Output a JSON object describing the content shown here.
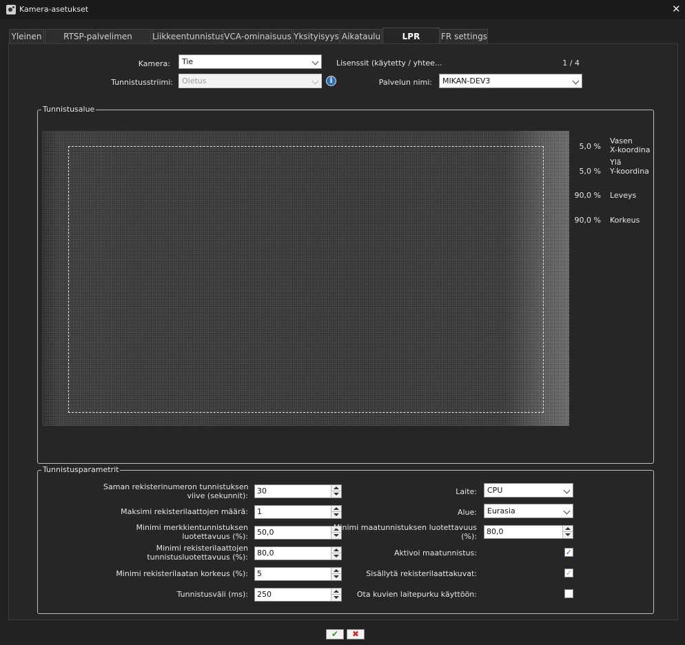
{
  "window": {
    "title": "Kamera-asetukset"
  },
  "tabs": [
    {
      "label": "Yleinen"
    },
    {
      "label": "RTSP-palvelimen striimaus"
    },
    {
      "label": "Liikkeentunnistus"
    },
    {
      "label": "VCA-ominaisuus"
    },
    {
      "label": "Yksityisyys"
    },
    {
      "label": "Aikataulu"
    },
    {
      "label": "LPR settings"
    },
    {
      "label": "FR settings"
    }
  ],
  "active_tab": "LPR settings",
  "top": {
    "camera_label": "Kamera:",
    "camera_value": "Tie",
    "stream_label": "Tunnistusstriimi:",
    "stream_value": "Oletus",
    "licenses_label": "Lisenssit (käytetty / yhtee...",
    "licenses_value": "1 / 4",
    "server_label": "Palvelun nimi:",
    "server_value": "MIKAN-DEV3"
  },
  "area": {
    "legend": "Tunnistusalue",
    "left_x": {
      "value": "5,0 %",
      "label_line1": "Vasen",
      "label_line2": "X-koordina"
    },
    "top_y": {
      "value": "5,0 %",
      "label_line1": "Ylä",
      "label_line2": "Y-koordina"
    },
    "width": {
      "value": "90,0 %",
      "label": "Leveys"
    },
    "height": {
      "value": "90,0 %",
      "label": "Korkeus"
    }
  },
  "params": {
    "legend": "Tunnistusparametrit",
    "left": [
      {
        "label_line1": "Saman rekisterinumeron tunnistuksen",
        "label_line2": "viive (sekunnit):",
        "value": "30"
      },
      {
        "label_line1": "Maksimi rekisterilaattojen määrä:",
        "label_line2": "",
        "value": "1"
      },
      {
        "label_line1": "Minimi merkkientunnistuksen",
        "label_line2": "luotettavuus (%):",
        "value": "50,0"
      },
      {
        "label_line1": "Minimi rekisterilaattojen",
        "label_line2": "tunnistusluotettavuus (%):",
        "value": "80,0"
      },
      {
        "label_line1": "Minimi rekisterilaatan korkeus (%):",
        "label_line2": "",
        "value": "5"
      },
      {
        "label_line1": "Tunnistusväli (ms):",
        "label_line2": "",
        "value": "250"
      }
    ],
    "device_label": "Laite:",
    "device_value": "CPU",
    "region_label": "Alue:",
    "region_value": "Eurasia",
    "country_conf_label_line1": "Minimi maatunnistuksen luotettavuus",
    "country_conf_label_line2": "(%):",
    "country_conf_value": "80,0",
    "enable_country_label": "Aktivoi maatunnistus:",
    "enable_country_checked": true,
    "include_images_label": "Sisällytä rekisterilaattakuvat:",
    "include_images_checked": true,
    "hw_decode_label": "Ota kuvien laitepurku käyttöön:",
    "hw_decode_checked": false
  },
  "buttons": {
    "ok": "✔",
    "cancel": "✖"
  },
  "colors": {
    "background": "#222222",
    "panel": "#262626",
    "ok": "#2e9a2e",
    "cancel": "#d22a2a",
    "check": "#2b5fa8"
  }
}
